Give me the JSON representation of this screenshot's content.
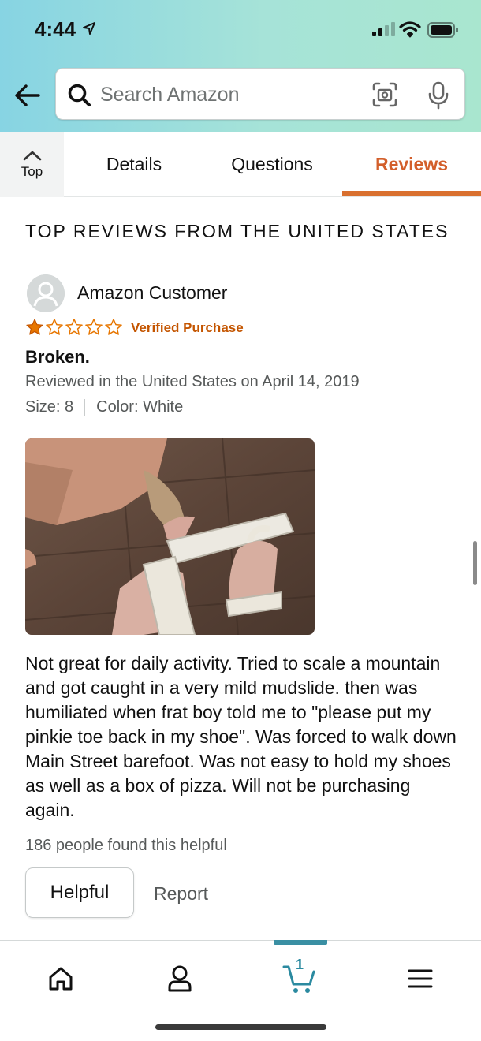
{
  "status_bar": {
    "time": "4:44",
    "location_icon": "location-arrow-icon",
    "signal_icon": "cellular-signal-icon",
    "wifi_icon": "wifi-icon",
    "battery_icon": "battery-icon"
  },
  "header": {
    "back_icon": "back-arrow-icon",
    "search": {
      "placeholder": "Search Amazon",
      "value": "",
      "icons": [
        "search-icon",
        "camera-scan-icon",
        "microphone-icon"
      ]
    },
    "background_colors": [
      "#87d4e3",
      "#a9e6cf"
    ]
  },
  "tabs": {
    "top_label": "Top",
    "items": [
      {
        "label": "Details",
        "active": false
      },
      {
        "label": "Questions",
        "active": false
      },
      {
        "label": "Reviews",
        "active": true
      }
    ],
    "active_color": "#d35f2b"
  },
  "reviews": {
    "section_title": "TOP REVIEWS FROM THE UNITED STATES",
    "review": {
      "reviewer": "Amazon Customer",
      "rating": 1,
      "rating_max": 5,
      "verified": "Verified Purchase",
      "title": "Broken.",
      "date": "Reviewed in the United States on April 14, 2019",
      "size": "Size: 8",
      "color": "Color: White",
      "body": "Not great for daily activity. Tried to scale a mountain and got caught in a very mild mudslide. then was humiliated when frat boy told me to \"please put my pinkie toe back in my shoe\". Was forced to walk down Main Street barefoot. Was not easy to hold my shoes as well as a box of pizza. Will not be purchasing again.",
      "helpful_count": "186 people found this helpful",
      "helpful_button": "Helpful",
      "report_link": "Report"
    },
    "star_color": "#e77600",
    "verified_color": "#c45500"
  },
  "bottom_nav": {
    "items": [
      {
        "icon": "home-icon"
      },
      {
        "icon": "account-icon"
      },
      {
        "icon": "cart-icon",
        "badge": "1",
        "active": true
      },
      {
        "icon": "menu-icon"
      }
    ],
    "active_color": "#3a8fa3"
  }
}
